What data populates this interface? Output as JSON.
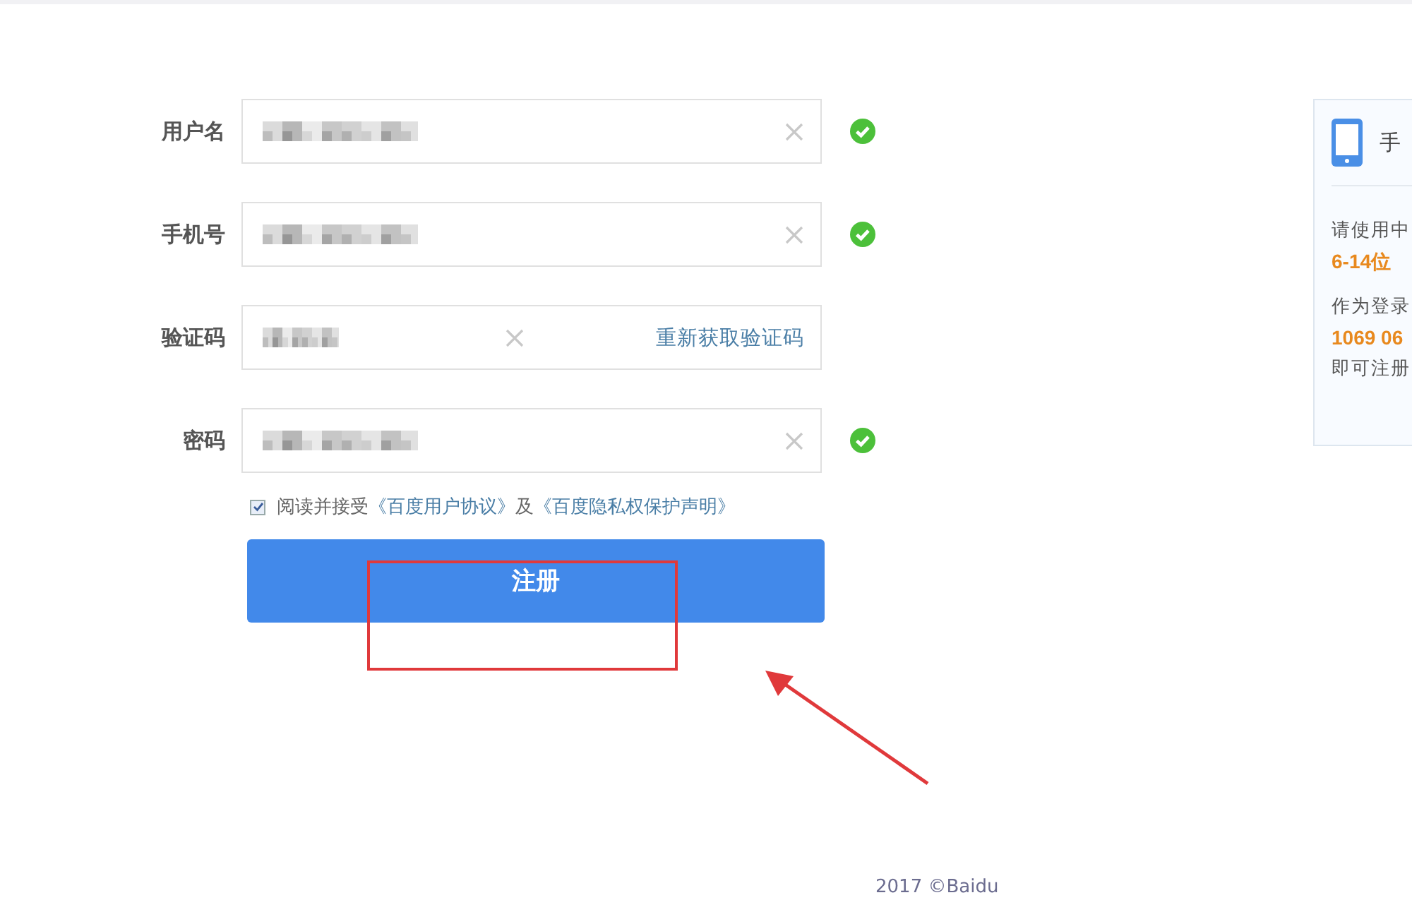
{
  "form": {
    "fields": [
      {
        "label": "用户名",
        "kind": "text",
        "valid": true
      },
      {
        "label": "手机号",
        "kind": "text",
        "valid": true
      },
      {
        "label": "验证码",
        "kind": "code",
        "valid": false,
        "action": "重新获取验证码"
      },
      {
        "label": "密码",
        "kind": "text",
        "valid": true
      }
    ],
    "agreement": {
      "checked": true,
      "prefix": "阅读并接受",
      "links": [
        "《百度用户协议》",
        "《百度隐私权保护声明》"
      ],
      "joiner": "及"
    },
    "submit": "注册"
  },
  "side_panel": {
    "title": "手",
    "lines": [
      {
        "text": "请使用中",
        "kind": "plain"
      },
      {
        "text": "6-14位",
        "kind": "highlight"
      },
      {
        "text": "作为登录",
        "kind": "plain"
      },
      {
        "text": "1069 06",
        "kind": "highlight"
      },
      {
        "text": "即可注册",
        "kind": "plain"
      }
    ]
  },
  "footer": "2017 ©Baidu"
}
